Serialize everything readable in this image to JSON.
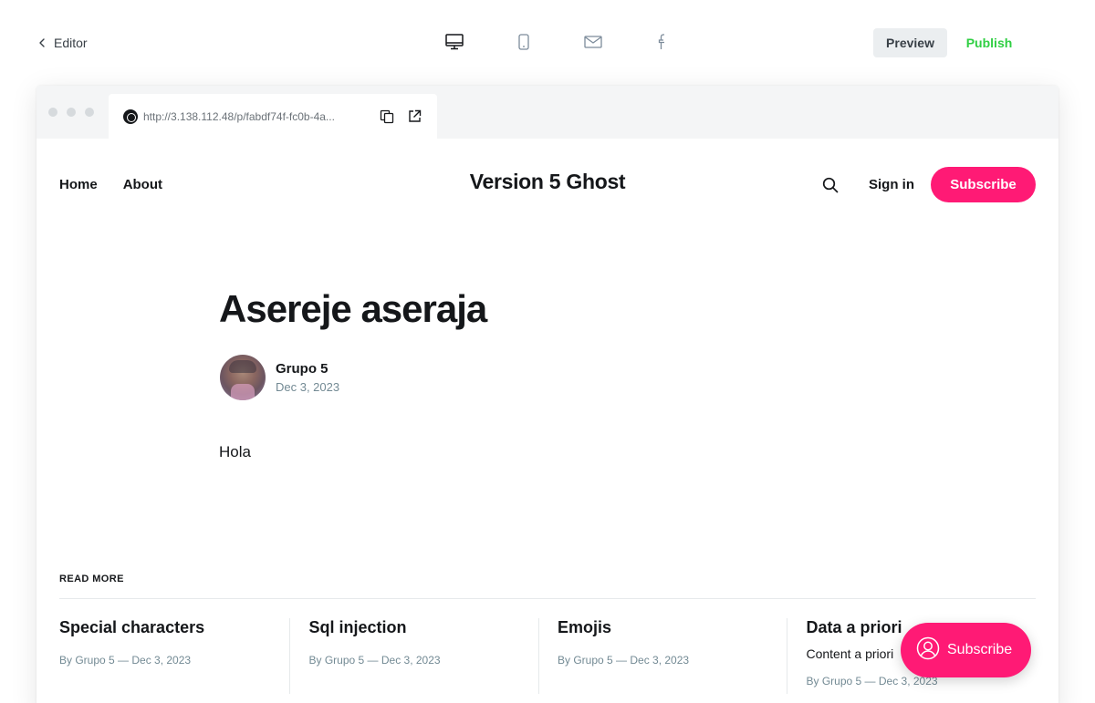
{
  "topbar": {
    "back_label": "Editor",
    "preview_label": "Preview",
    "publish_label": "Publish",
    "devices": [
      "desktop-icon",
      "mobile-icon",
      "email-icon",
      "facebook-icon"
    ],
    "publish_color": "#30cf43"
  },
  "browser": {
    "url": "http://3.138.112.48/p/fabdf74f-fc0b-4a..."
  },
  "site": {
    "nav": [
      "Home",
      "About"
    ],
    "title": "Version 5 Ghost",
    "signin_label": "Sign in",
    "subscribe_label": "Subscribe",
    "accent_color": "#ff1a75"
  },
  "post": {
    "title": "Asereje aseraja",
    "author": "Grupo 5",
    "date": "Dec 3, 2023",
    "body": "Hola"
  },
  "read_more": {
    "heading": "READ MORE",
    "cards": [
      {
        "title": "Special characters",
        "excerpt": "",
        "meta": "By Grupo 5 — Dec 3, 2023"
      },
      {
        "title": "Sql injection",
        "excerpt": "",
        "meta": "By Grupo 5 — Dec 3, 2023"
      },
      {
        "title": "Emojis",
        "excerpt": "",
        "meta": "By Grupo 5 — Dec 3, 2023"
      },
      {
        "title": "Data a priori",
        "excerpt": "Content a priori",
        "meta": "By Grupo 5 — Dec 3, 2023"
      }
    ]
  },
  "portal": {
    "label": "Subscribe"
  }
}
